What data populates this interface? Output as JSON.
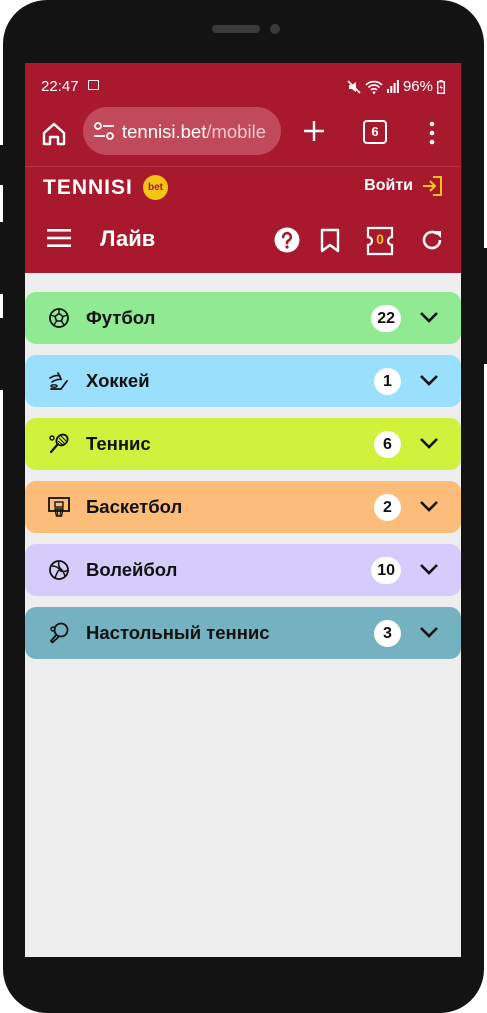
{
  "status_bar": {
    "time": "22:47",
    "battery": "96%"
  },
  "browser": {
    "url_host": "tennisi.bet",
    "url_path": "/mobile",
    "tab_count": "6"
  },
  "header": {
    "logo": "TENNISI",
    "logo_badge": "bet",
    "login_label": "Войти",
    "page_title": "Лайв",
    "coupon_count": "0"
  },
  "colors": {
    "brand": "#a8192e",
    "accent": "#f5c516"
  },
  "sports": [
    {
      "name": "Футбол",
      "count": "22",
      "color": "#90ea91",
      "icon": "soccer-ball-icon"
    },
    {
      "name": "Хоккей",
      "count": "1",
      "color": "#9adffb",
      "icon": "hockey-icon"
    },
    {
      "name": "Теннис",
      "count": "6",
      "color": "#d0f23c",
      "icon": "tennis-racket-icon"
    },
    {
      "name": "Баскетбол",
      "count": "2",
      "color": "#fdbd7a",
      "icon": "basketball-hoop-icon"
    },
    {
      "name": "Волейбол",
      "count": "10",
      "color": "#d6ccfb",
      "icon": "volleyball-icon"
    },
    {
      "name": "Настольный теннис",
      "count": "3",
      "color": "#75b2c1",
      "icon": "table-tennis-icon"
    }
  ]
}
